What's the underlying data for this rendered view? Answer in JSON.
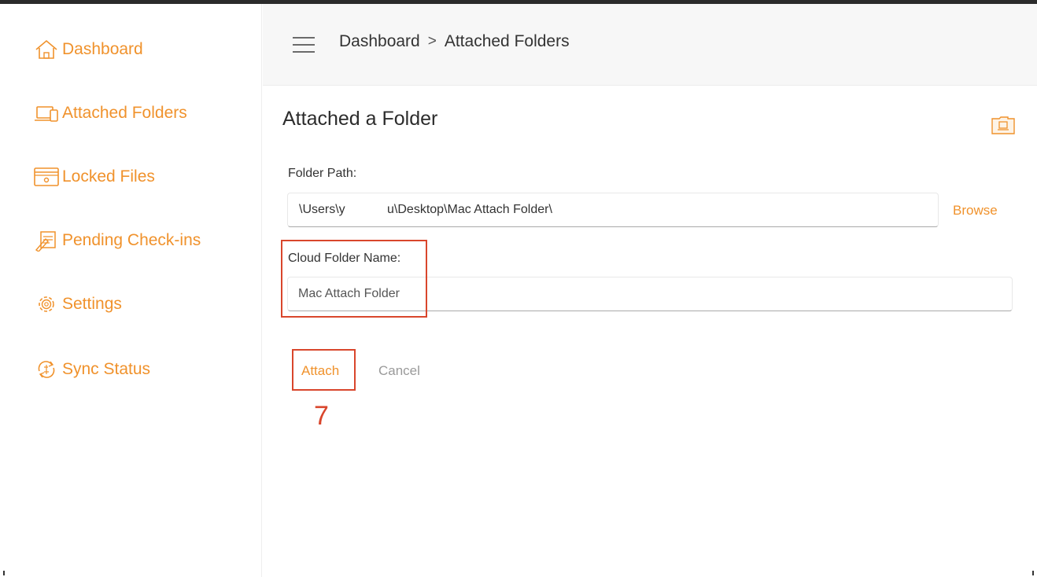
{
  "sidebar": {
    "items": [
      {
        "label": "Dashboard",
        "icon": "home-icon"
      },
      {
        "label": "Attached Folders",
        "icon": "devices-icon"
      },
      {
        "label": "Locked Files",
        "icon": "lock-window-icon"
      },
      {
        "label": "Pending Check-ins",
        "icon": "edit-doc-icon"
      },
      {
        "label": "Settings",
        "icon": "gear-icon"
      },
      {
        "label": "Sync Status",
        "icon": "sync-icon"
      }
    ]
  },
  "header": {
    "breadcrumb_root": "Dashboard",
    "breadcrumb_separator": ">",
    "breadcrumb_current": "Attached Folders"
  },
  "main": {
    "title": "Attached a Folder",
    "folder_path_label": "Folder Path:",
    "folder_path_value": "\\Users\\y            u\\Desktop\\Mac Attach Folder\\",
    "browse_label": "Browse",
    "cloud_folder_label": "Cloud Folder Name:",
    "cloud_folder_placeholder": "Mac Attach Folder",
    "attach_label": "Attach",
    "cancel_label": "Cancel"
  },
  "annotation": {
    "step_number": "7"
  },
  "colors": {
    "accent": "#f0922c",
    "annotation_red": "#d9462c",
    "muted": "#9a9a9a"
  }
}
